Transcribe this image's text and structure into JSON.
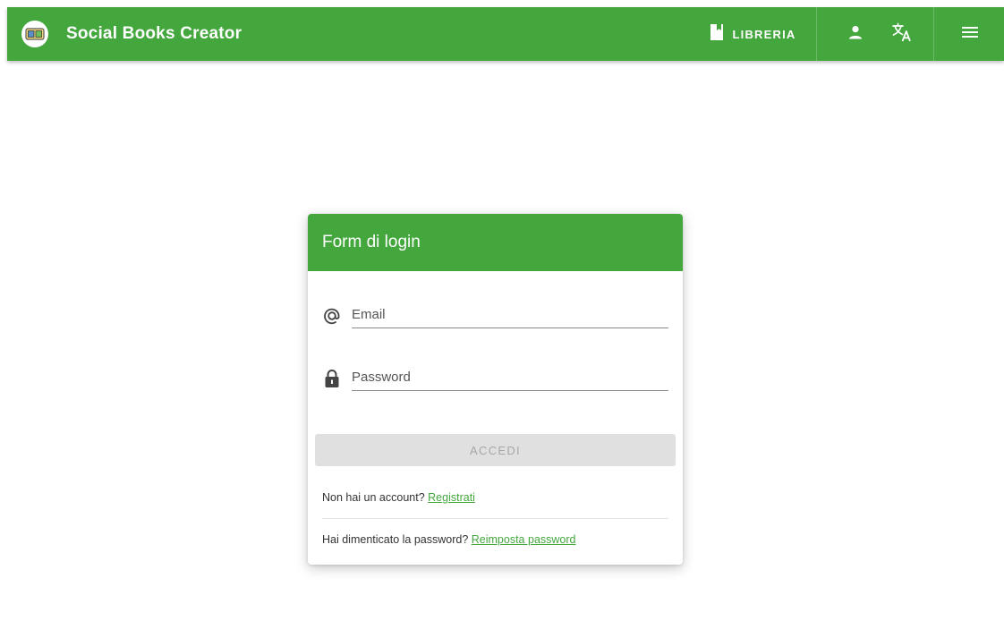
{
  "app": {
    "title": "Social Books Creator"
  },
  "toolbar": {
    "library_label": "LIBRERIA",
    "account_icon": "person-icon",
    "language_icon": "translate-icon",
    "menu_icon": "menu-icon"
  },
  "login": {
    "title": "Form di login",
    "email_placeholder": "Email",
    "password_placeholder": "Password",
    "submit_label": "ACCEDI",
    "register_prompt": "Non hai un account?",
    "register_link": "Registrati",
    "reset_prompt": "Hai dimenticato la password?",
    "reset_link": "Reimposta password"
  },
  "colors": {
    "primary": "#43a73d",
    "disabled_button": "#e0e0e0",
    "disabled_text": "#a7a7a7"
  }
}
